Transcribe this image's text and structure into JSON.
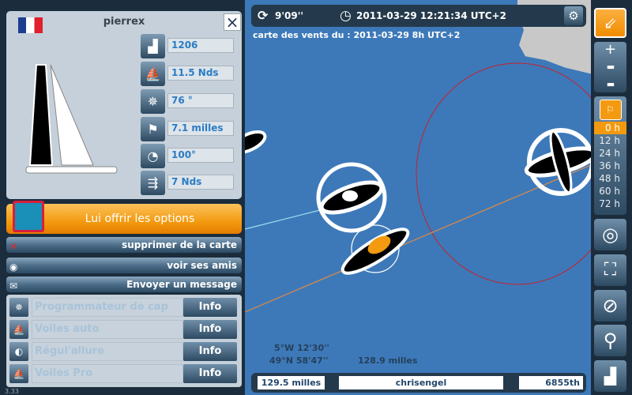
{
  "player": {
    "name": "pierrex",
    "flag": "france-flag",
    "close": "×",
    "stats": [
      {
        "icon": "ranking-podium-icon",
        "value": "1206"
      },
      {
        "icon": "sail-speed-icon",
        "value": "11.5 Nds"
      },
      {
        "icon": "compass-heading-icon",
        "value": "76 °"
      },
      {
        "icon": "buoy-distance-icon",
        "value": "7.1 milles"
      },
      {
        "icon": "wind-angle-icon",
        "value": "100°"
      },
      {
        "icon": "wind-speed-icon",
        "value": "7 Nds"
      }
    ]
  },
  "actions": {
    "gift": "Lui offrir les options",
    "remove": "supprimer de la carte",
    "friends": "voir ses amis",
    "message": "Envoyer un message"
  },
  "options": [
    {
      "label": "Programmateur de cap",
      "info": "Info",
      "icon": "compass-icon"
    },
    {
      "label": "Voiles auto",
      "info": "Info",
      "icon": "sails-icon"
    },
    {
      "label": "Régul'allure",
      "info": "Info",
      "icon": "regulator-icon"
    },
    {
      "label": "Voiles Pro",
      "info": "Info",
      "icon": "sails-plus-icon"
    }
  ],
  "version": "3.33",
  "topbar": {
    "refresh": "9'09''",
    "datetime": "2011-03-29 12:21:34 UTC+2",
    "wind_map": "carte des vents du : 2011-03-29 8h UTC+2"
  },
  "coords": {
    "lon": "5°W 12'30''",
    "lat": "49°N 58'47''",
    "distance": "128.9 milles"
  },
  "bottombar": {
    "distance": "129.5 milles",
    "player": "chrisengel",
    "rank": "6855th"
  },
  "forecast": {
    "hours": [
      "0 h",
      "12 h",
      "24 h",
      "36 h",
      "48 h",
      "60 h",
      "72 h"
    ],
    "selected": "0 h"
  },
  "colors": {
    "accent": "#f39a10",
    "sea": "#3d79b9",
    "land": "#c8c8c8",
    "panel": "#1b2d3d"
  }
}
